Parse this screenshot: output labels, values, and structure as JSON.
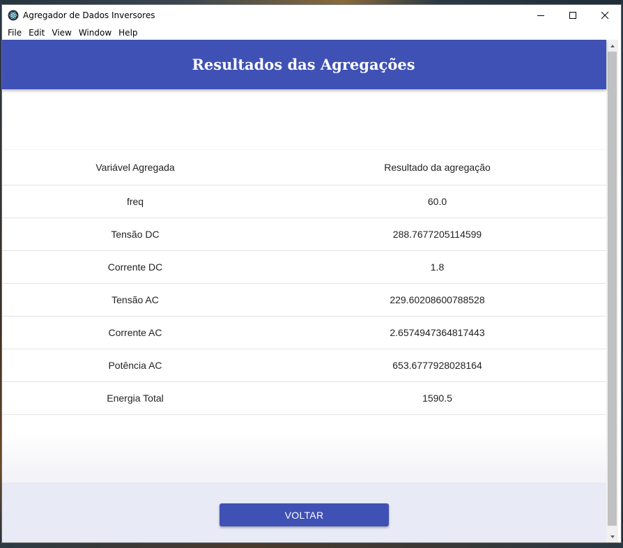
{
  "window": {
    "title": "Agregador de Dados Inversores",
    "app_icon": "electron-icon"
  },
  "menu": {
    "items": [
      "File",
      "Edit",
      "View",
      "Window",
      "Help"
    ]
  },
  "header": {
    "title": "Resultados das Agregações",
    "color": "#3f51b5"
  },
  "table": {
    "columns": [
      "Variável Agregada",
      "Resultado da agregação"
    ],
    "rows": [
      [
        "freq",
        "60.0"
      ],
      [
        "Tensão DC",
        "288.7677205114599"
      ],
      [
        "Corrente DC",
        "1.8"
      ],
      [
        "Tensão AC",
        "229.60208600788528"
      ],
      [
        "Corrente AC",
        "2.6574947364817443"
      ],
      [
        "Potência AC",
        "653.6777928028164"
      ],
      [
        "Energia Total",
        "1590.5"
      ]
    ]
  },
  "footer": {
    "back_label": "VOLTAR"
  }
}
